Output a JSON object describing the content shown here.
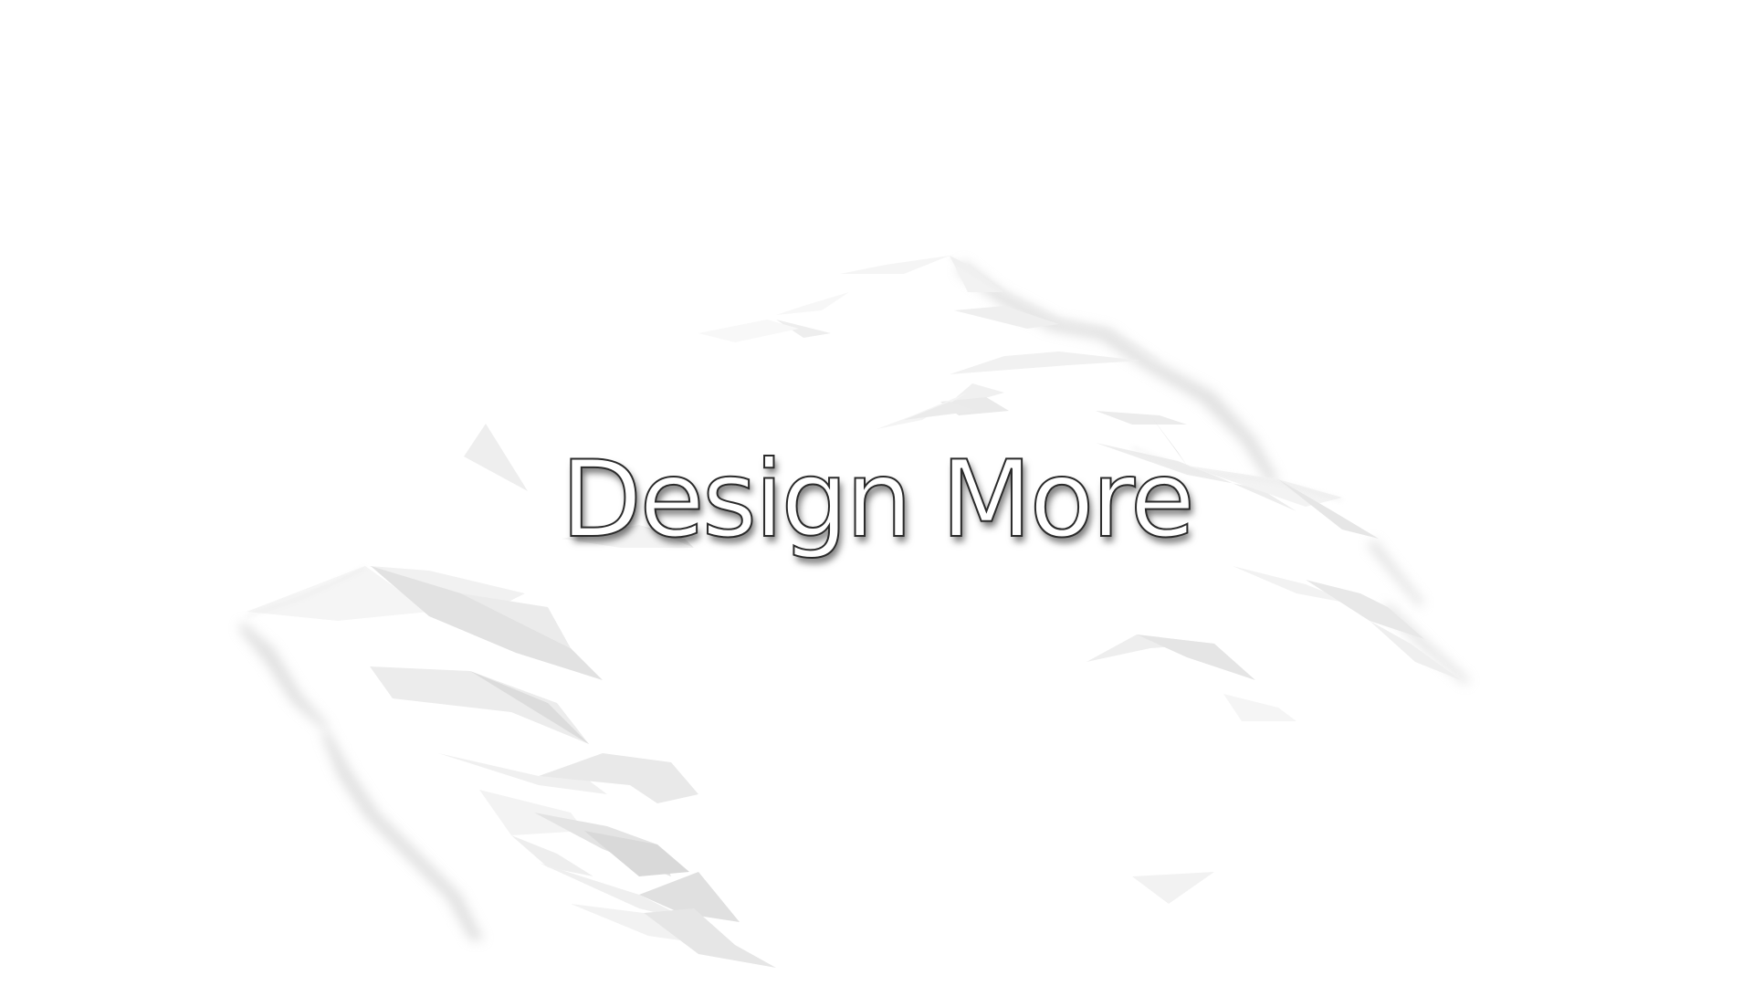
{
  "hero": {
    "title": "Design More"
  },
  "colors": {
    "background": "#ffffff",
    "title_fill": "#ffffff",
    "title_outline": "#2a2a2a",
    "facet_light": "#f4f4f4",
    "facet_mid": "#e6e6e6",
    "facet_dark": "#d4d4d4"
  }
}
